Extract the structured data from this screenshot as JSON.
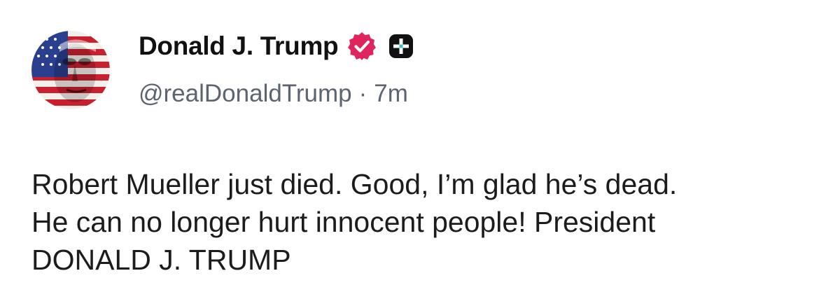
{
  "post": {
    "author": {
      "display_name": "Donald J. Trump",
      "handle": "@realDonaldTrump",
      "separator": "·",
      "timestamp": "7m",
      "avatar_icon": "patriotic-portrait-avatar",
      "verified_icon": "verified-badge-icon",
      "verified_color": "#e0245e",
      "plus_icon": "plus-badge-icon",
      "plus_color": "#111111"
    },
    "body_lines": [
      "Robert Mueller just died. Good, I’m glad he’s dead.",
      "He can no longer hurt innocent people! President",
      "DONALD J. TRUMP"
    ]
  }
}
